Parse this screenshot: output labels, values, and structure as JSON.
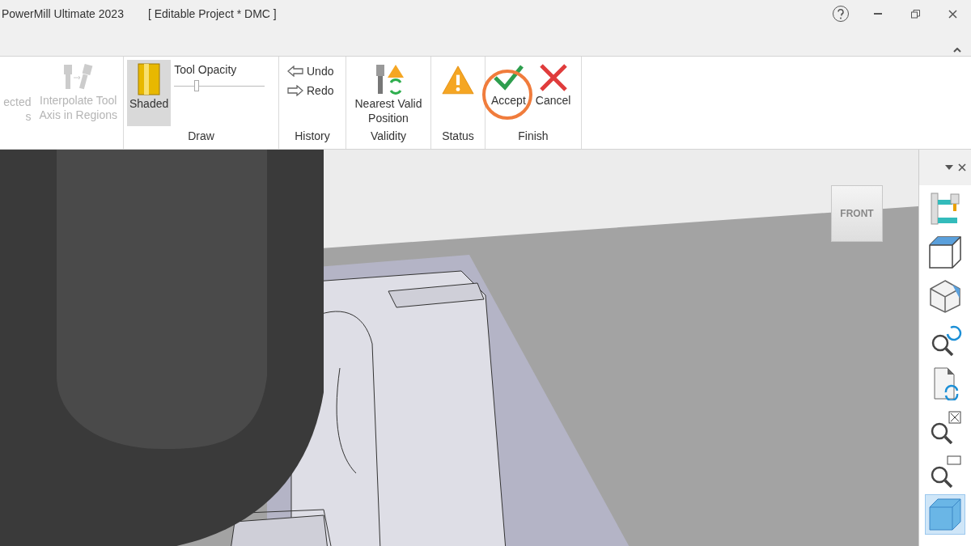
{
  "window": {
    "title": "PowerMill Ultimate 2023",
    "project": "[ Editable Project * DMC ]"
  },
  "ribbon": {
    "groups": [
      {
        "kind": "tools",
        "buttons": [
          {
            "lines": [
              "ected",
              "s"
            ],
            "disabled": true
          },
          {
            "lines": [
              "Interpolate Tool",
              "Axis in Regions"
            ],
            "disabled": true
          }
        ]
      },
      {
        "kind": "draw",
        "label": "Draw",
        "shaded": {
          "label": "Shaded",
          "selected": true
        },
        "opacity": {
          "label": "Tool Opacity",
          "level": 0.25
        }
      },
      {
        "kind": "history",
        "label": "History",
        "buttons": [
          {
            "label": "Undo"
          },
          {
            "label": "Redo"
          }
        ]
      },
      {
        "kind": "validity",
        "label": "Validity",
        "buttons": [
          {
            "lines": [
              "Nearest Valid",
              "Position"
            ]
          }
        ]
      },
      {
        "kind": "status",
        "label": "Status"
      },
      {
        "kind": "finish",
        "label": "Finish",
        "buttons": [
          {
            "label": "Accept",
            "highlighted": true
          },
          {
            "label": "Cancel",
            "highlighted": false
          }
        ]
      }
    ]
  },
  "viewport": {
    "view_cube": "FRONT"
  },
  "view_toolbar": {
    "buttons": [
      {
        "selected": false
      },
      {
        "selected": false
      },
      {
        "selected": false
      },
      {
        "selected": false
      },
      {
        "selected": false
      },
      {
        "selected": false
      },
      {
        "selected": false
      },
      {
        "selected": true
      }
    ]
  }
}
